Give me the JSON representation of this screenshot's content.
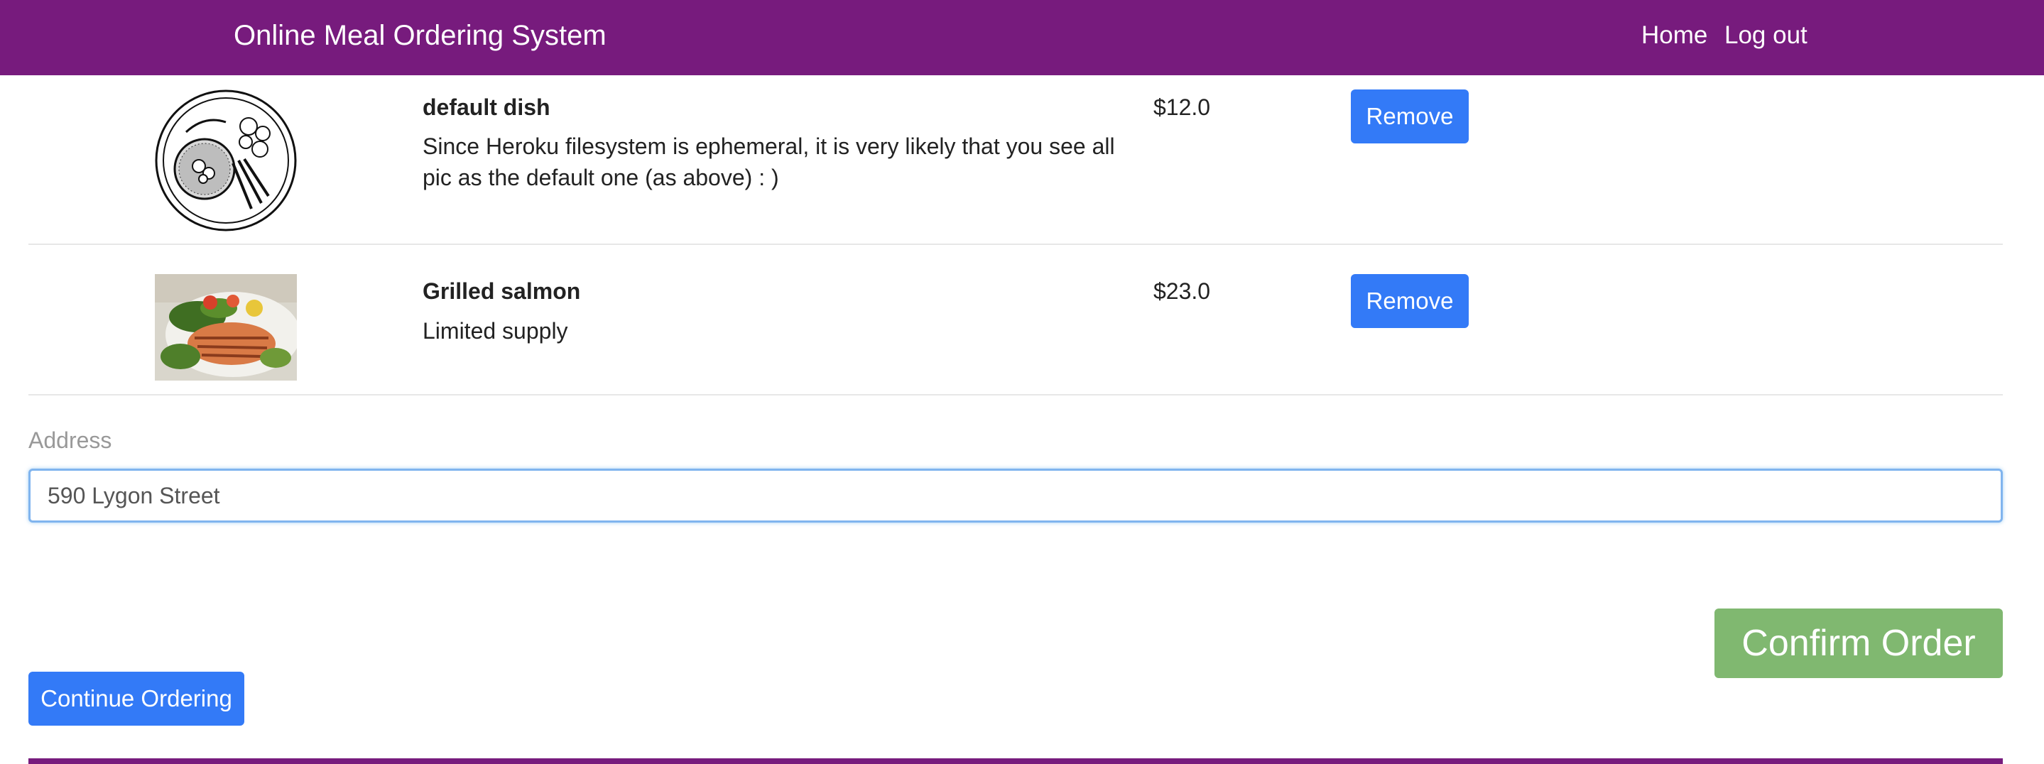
{
  "navbar": {
    "brand": "Online Meal Ordering System",
    "links": [
      {
        "label": "Home"
      },
      {
        "label": "Log out"
      }
    ],
    "color": "#771b7d"
  },
  "cart": {
    "items": [
      {
        "name": "default dish",
        "description": "Since Heroku filesystem is ephemeral, it is very likely that you see all pic as the default one (as above) : )",
        "price": "$12.0",
        "image_icon": "plate-illustration-icon",
        "remove_label": "Remove"
      },
      {
        "name": "Grilled salmon",
        "description": "Limited supply",
        "price": "$23.0",
        "image_icon": "grilled-salmon-photo",
        "remove_label": "Remove"
      }
    ]
  },
  "address": {
    "label": "Address",
    "value": "590 Lygon Street"
  },
  "actions": {
    "confirm_label": "Confirm Order",
    "continue_label": "Continue Ordering",
    "confirm_color": "#80b870",
    "primary_color": "#337af7"
  }
}
